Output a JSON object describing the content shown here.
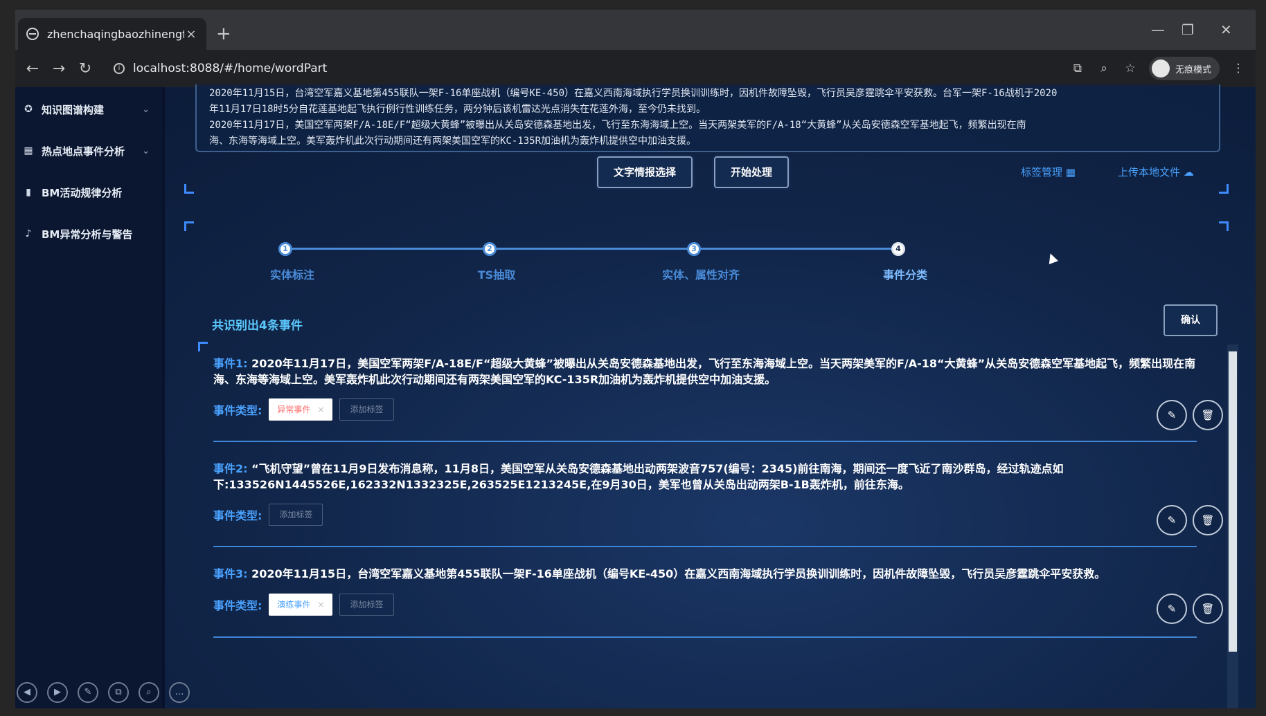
{
  "browser": {
    "tab_title": "zhenchaqingbaozhinengfenxi",
    "tab_close": "×",
    "new_tab": "+",
    "url": "localhost:8088/#/home/wordPart",
    "incognito_label": "无痕模式",
    "win_min": "—",
    "win_restore": "❐",
    "win_close": "✕"
  },
  "sidebar": {
    "items": [
      {
        "label": "知识图谱构建",
        "icon": "gear-icon",
        "has_chevron": true
      },
      {
        "label": "热点地点事件分析",
        "icon": "grid-icon",
        "has_chevron": true
      },
      {
        "label": "BM活动规律分析",
        "icon": "bar-chart-icon",
        "has_chevron": false
      },
      {
        "label": "BM异常分析与警告",
        "icon": "bell-icon",
        "has_chevron": false
      }
    ],
    "chevron": "⌄"
  },
  "source_text": {
    "line1": "2020年11月15日，台湾空军嘉义基地第455联队一架F-16单座战机（编号KE-450）在嘉义西南海域执行学员换训训练时，因机件故障坠毁，飞行员吴彦霆跳伞平安获救。台军一架F-16战机于2020",
    "line2": "年11月17日18时5分自花莲基地起飞执行例行性训练任务，两分钟后该机雷达光点消失在花莲外海，至今仍未找到。",
    "line3": "2020年11月17日，美国空军两架F/A-18E/F“超级大黄蜂”被曝出从关岛安德森基地出发，飞行至东海海域上空。当天两架美军的F/A-18“大黄蜂”从关岛安德森空军基地起飞，频繁出现在南",
    "line4": "海、东海等海域上空。美军轰炸机此次行动期间还有两架美国空军的KC-135R加油机为轰炸机提供空中加油支援。"
  },
  "toolbar": {
    "select_btn": "文字情报选择",
    "process_btn": "开始处理",
    "tag_manage": "标签管理",
    "upload": "上传本地文件"
  },
  "steps": [
    {
      "num": "1",
      "label": "实体标注"
    },
    {
      "num": "2",
      "label": "TS抽取"
    },
    {
      "num": "3",
      "label": "实体、属性对齐"
    },
    {
      "num": "4",
      "label": "事件分类"
    }
  ],
  "summary": "共识别出4条事件",
  "confirm_btn": "确认",
  "event_type_label": "事件类型:",
  "add_tag_label": "添加标签",
  "events": [
    {
      "label": "事件1:",
      "text": "2020年11月17日，美国空军两架F/A-18E/F“超级大黄蜂”被曝出从关岛安德森基地出发，飞行至东海海域上空。当天两架美军的F/A-18“大黄蜂”从关岛安德森空军基地起飞，频繁出现在南海、东海等海域上空。美军轰炸机此次行动期间还有两架美国空军的KC-135R加油机为轰炸机提供空中加油支援。",
      "tag": "异常事件",
      "tag_color": "#ff6b6b"
    },
    {
      "label": "事件2:",
      "text": "“飞机守望”曾在11月9日发布消息称，11月8日，美国空军从关岛安德森基地出动两架波音757(编号：2345)前往南海，期间还一度飞近了南沙群岛，经过轨迹点如下:133526N1445526E,162332N1332325E,263525E1213245E,在9月30日，美军也曾从关岛出动两架B-1B轰炸机，前往东海。",
      "tag": "",
      "tag_color": ""
    },
    {
      "label": "事件3:",
      "text": "2020年11月15日，台湾空军嘉义基地第455联队一架F-16单座战机（编号KE-450）在嘉义西南海域执行学员换训训练时，因机件故障坠毁，飞行员吴彦霆跳伞平安获救。",
      "tag": "演练事件",
      "tag_color": "#4aa2ff"
    }
  ],
  "tag_close": "×",
  "colors": {
    "accent": "#4aa2ff",
    "summary": "#5cc9ff",
    "background": "#0e1f3b"
  }
}
